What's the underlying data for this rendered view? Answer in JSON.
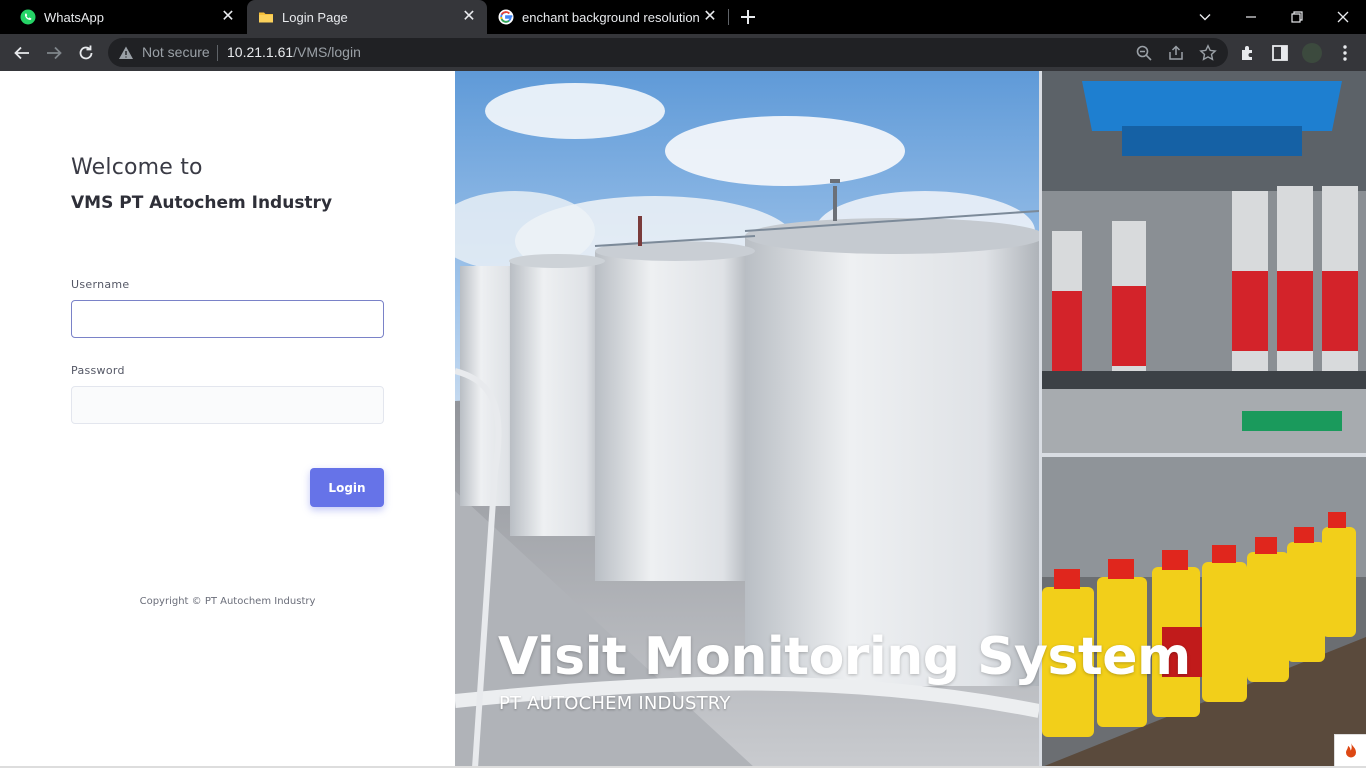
{
  "browser": {
    "tabs": [
      {
        "title": "WhatsApp",
        "icon": "whatsapp-icon",
        "active": false
      },
      {
        "title": "Login Page",
        "icon": "folder-icon",
        "active": true
      },
      {
        "title": "enchant background resolution h",
        "icon": "google-icon",
        "active": false
      }
    ],
    "not_secure": "Not secure",
    "url_host": "10.21.1.61",
    "url_path": "/VMS/login"
  },
  "login": {
    "welcome": "Welcome to",
    "company": "VMS PT Autochem Industry",
    "username_label": "Username",
    "username_value": "",
    "password_label": "Password",
    "password_value": "",
    "login_button": "Login",
    "copyright": "Copyright © PT Autochem Industry"
  },
  "hero": {
    "title": "Visit Monitoring System",
    "subtitle": "PT AUTOCHEM INDUSTRY"
  },
  "colors": {
    "accent": "#6673e8",
    "chrome_dark": "#35363a"
  }
}
